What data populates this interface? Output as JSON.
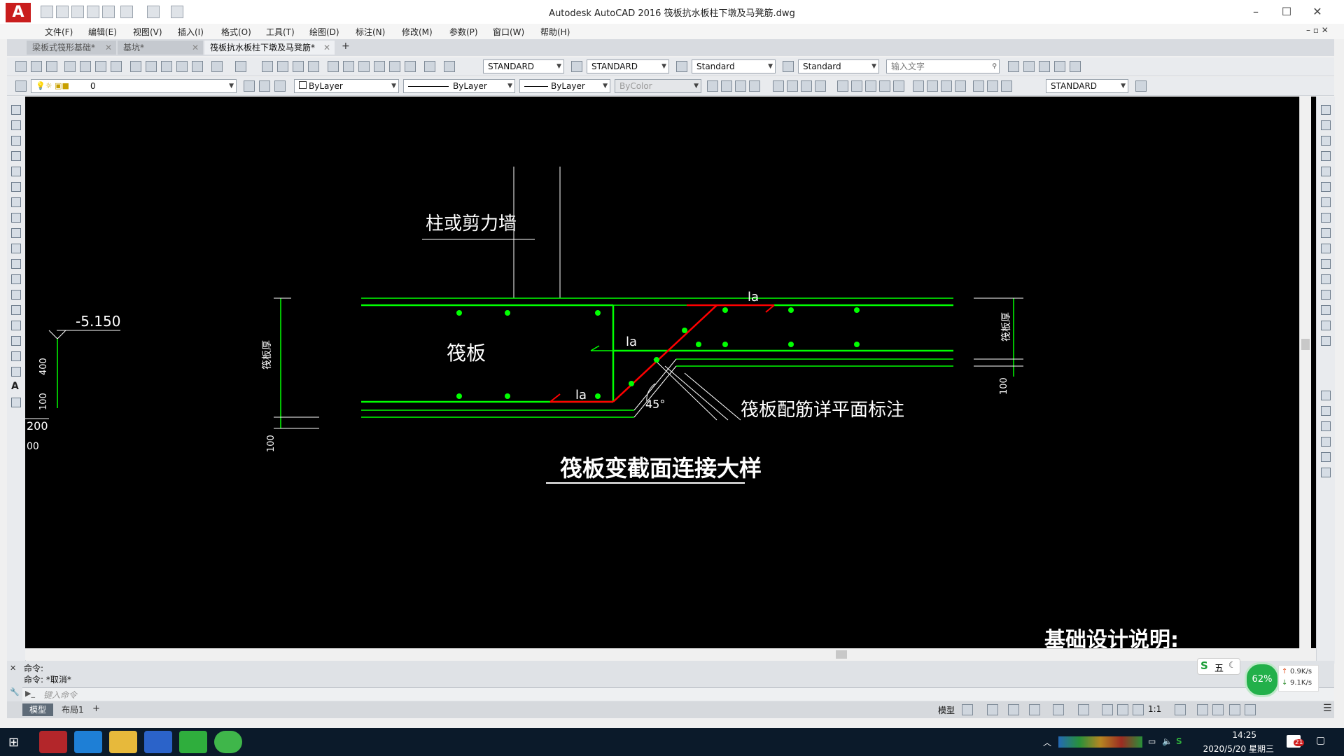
{
  "window": {
    "title": "Autodesk AutoCAD 2016    筏板抗水板柱下墩及马凳筋.dwg",
    "app_logo": "A"
  },
  "menu": [
    "文件(F)",
    "编辑(E)",
    "视图(V)",
    "插入(I)",
    "格式(O)",
    "工具(T)",
    "绘图(D)",
    "标注(N)",
    "修改(M)",
    "参数(P)",
    "窗口(W)",
    "帮助(H)"
  ],
  "tabs": [
    {
      "label": "梁板式筏形基础*",
      "active": false
    },
    {
      "label": "基坑*",
      "active": false
    },
    {
      "label": "筏板抗水板柱下墩及马凳筋*",
      "active": true
    }
  ],
  "new_tab_glyph": "+",
  "toolbar": {
    "text_style": "STANDARD",
    "dim_style": "STANDARD",
    "table_style": "Standard",
    "multileader_style": "Standard",
    "search_placeholder": "输入文字",
    "layer": "0",
    "color": "ByLayer",
    "linetype": "ByLayer",
    "lineweight": "ByLayer",
    "plotstyle": "ByColor",
    "dim_style2": "STANDARD"
  },
  "drawing": {
    "wall_label": "柱或剪力墙",
    "raft_label": "筏板",
    "raft_thickness_label": "筏板厚",
    "la_label": "la",
    "angle_label": "45°",
    "note_label": "筏板配筋详平面标注",
    "title": "筏板变截面连接大样",
    "elevation": "-5.150",
    "dim_400": "400",
    "dim_100": "100",
    "dim_200": "200",
    "dim_00": "00",
    "footer_heading": "基础设计说明:"
  },
  "command": {
    "line1": "命令:",
    "line2": "命令: *取消*",
    "input_placeholder": "键入命令"
  },
  "layout_tabs": [
    "模型",
    "布局1"
  ],
  "status": {
    "model_label": "模型",
    "scale": "1:1"
  },
  "overlay": {
    "ime_label": "五",
    "cpu_percent": "62%",
    "net_up": "0.9K/s",
    "net_down": "9.1K/s"
  },
  "taskbar": {
    "time": "14:25",
    "date": "2020/5/20 星期三",
    "notification_count": "21"
  },
  "colors": {
    "rebar_green": "#00ff00",
    "highlight_red": "#ff0000",
    "canvas_bg": "#000000",
    "text_white": "#ffffff"
  }
}
